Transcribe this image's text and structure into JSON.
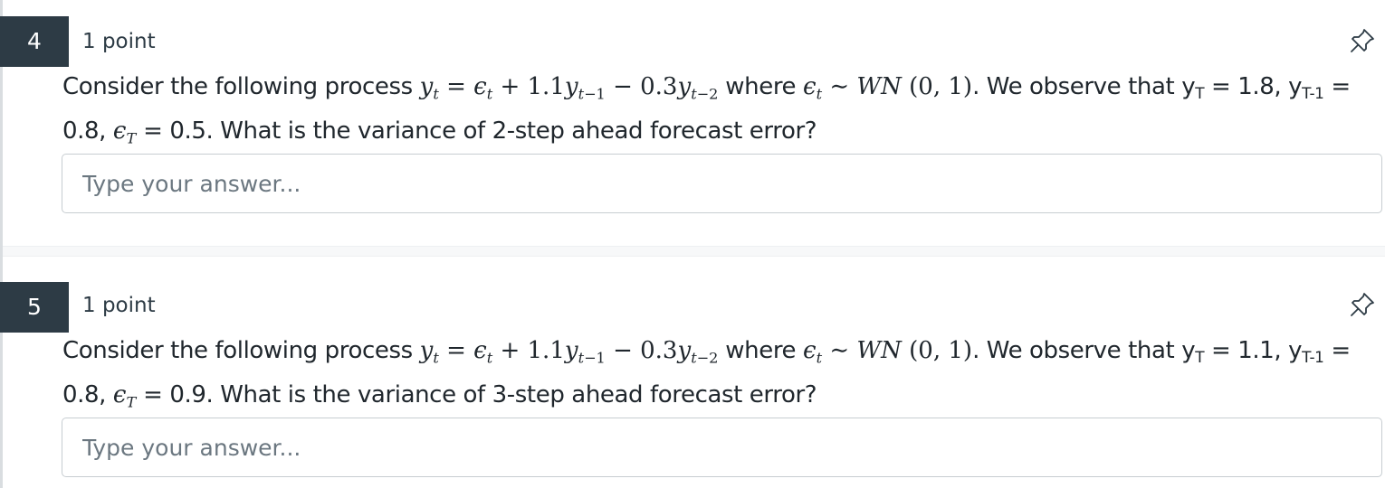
{
  "questions": [
    {
      "number": "4",
      "points": "1 point",
      "intro": "Consider the following process",
      "where": "where",
      "observe": ". We observe that y",
      "yT_value": " = 1.8, y",
      "ylag_value": " = 0.8,",
      "eT_value": " = 0.5. What is the variance of 2-step ahead forecast error?",
      "answer_placeholder": "Type your answer..."
    },
    {
      "number": "5",
      "points": "1 point",
      "intro": "Consider the following process",
      "where": "where",
      "observe": ". We observe that y",
      "yT_value": " = 1.1, y",
      "ylag_value": " = 0.8,",
      "eT_value": " = 0.9. What is the variance of 3-step ahead forecast error?",
      "answer_placeholder": "Type your answer..."
    }
  ],
  "icons": {
    "pin": "pin-icon"
  }
}
